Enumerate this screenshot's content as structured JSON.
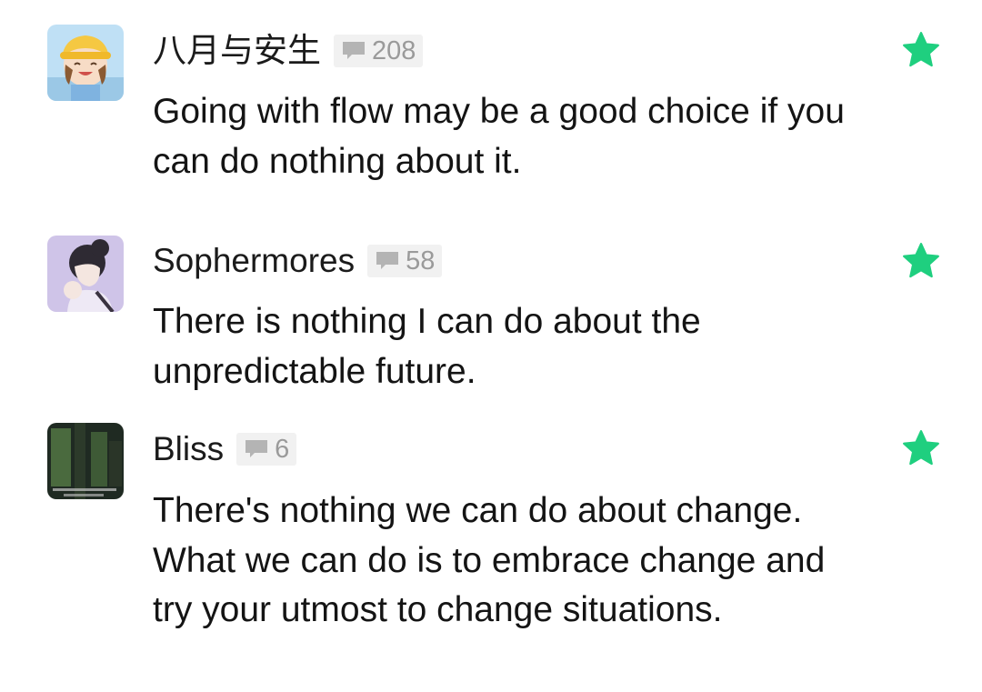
{
  "comments": [
    {
      "username": "八月与安生",
      "reply_count": "208",
      "text": "Going with flow may be a good choice if you can do nothing about it."
    },
    {
      "username": "Sophermores",
      "reply_count": "58",
      "text": "There is nothing I can do about the unpredictable future."
    },
    {
      "username": "Bliss",
      "reply_count": "6",
      "text": "There's nothing we can do about change. What we can do is to embrace change and try your utmost to change situations."
    }
  ],
  "colors": {
    "star": "#1fcf7f",
    "badge_bg": "#f1f1f1",
    "badge_text": "#9a9a9a"
  },
  "icons": {
    "reply_badge": "speech-bubble-icon",
    "favorite": "star-icon"
  }
}
